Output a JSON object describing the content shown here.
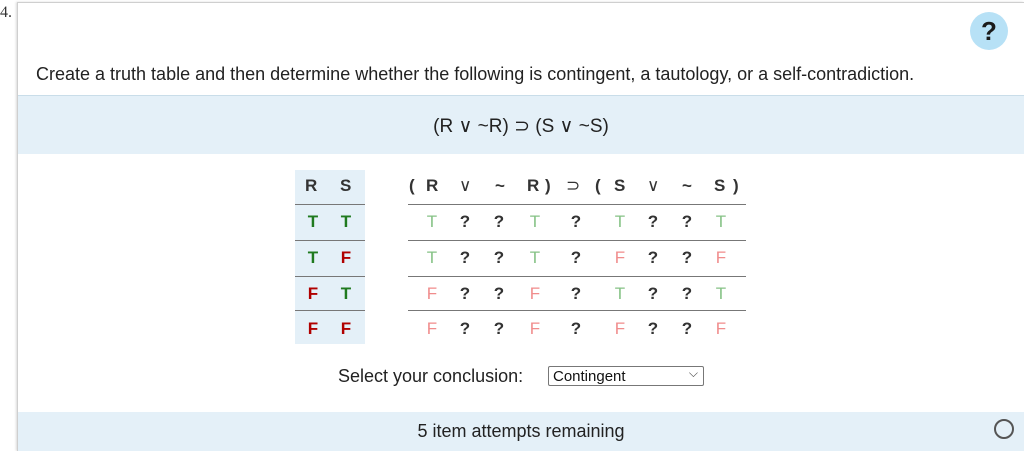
{
  "question_number": "4.",
  "help_label": "?",
  "prompt": "Create a truth table and then determine whether the following is contingent, a tautology, or a self-contradiction.",
  "expression": "(R ∨ ~R) ⊃ (S ∨ ~S)",
  "table": {
    "rs_headers": [
      "R",
      "S"
    ],
    "headers": [
      "(",
      "R",
      "∨",
      "~",
      "R",
      ")",
      "⊃",
      "(",
      "S",
      "∨",
      "~",
      "S",
      ")"
    ],
    "rows": [
      {
        "r": "T",
        "s": "T",
        "cells": [
          "T",
          "?",
          "?",
          "T",
          "?",
          "T",
          "?",
          "?",
          "T"
        ]
      },
      {
        "r": "T",
        "s": "F",
        "cells": [
          "T",
          "?",
          "?",
          "T",
          "?",
          "F",
          "?",
          "?",
          "F"
        ]
      },
      {
        "r": "F",
        "s": "T",
        "cells": [
          "F",
          "?",
          "?",
          "F",
          "?",
          "T",
          "?",
          "?",
          "T"
        ]
      },
      {
        "r": "F",
        "s": "F",
        "cells": [
          "F",
          "?",
          "?",
          "F",
          "?",
          "F",
          "?",
          "?",
          "F"
        ]
      }
    ]
  },
  "conclusion_label": "Select your conclusion:",
  "conclusion_value": "Contingent",
  "attempts_text": "5 item attempts remaining",
  "colors": {
    "true": "#1f7a1f",
    "false": "#b00000",
    "band": "#e4f0f8",
    "help": "#b7e1f6"
  }
}
